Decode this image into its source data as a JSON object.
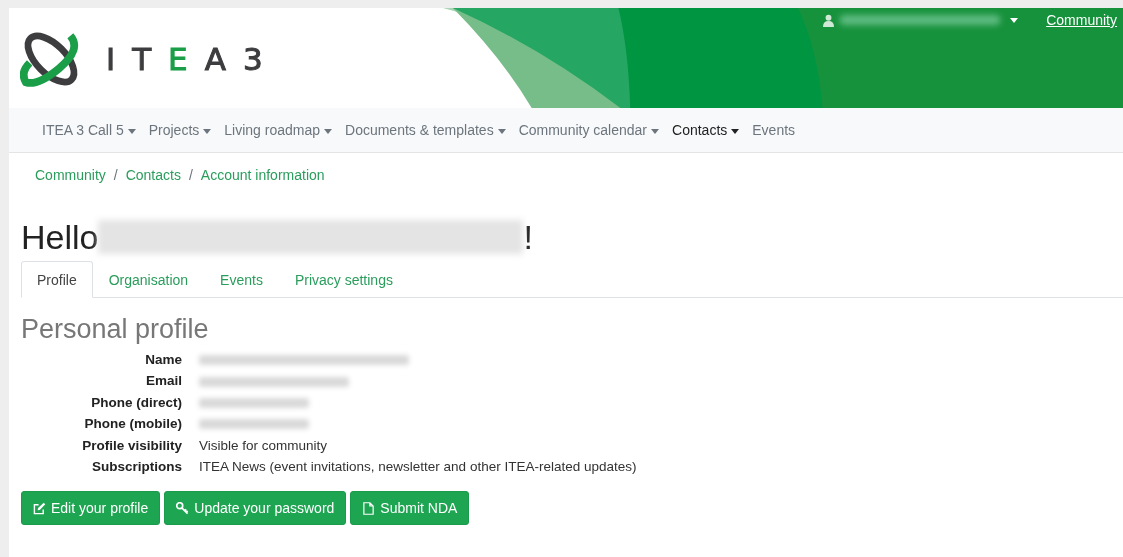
{
  "logo": {
    "letters": [
      {
        "char": "I",
        "color": "#3d3d3f"
      },
      {
        "char": "T",
        "color": "#3d3d3f"
      },
      {
        "char": "E",
        "color": "#1a9e48"
      },
      {
        "char": "A",
        "color": "#3d3d3f"
      },
      {
        "char": "3",
        "color": "#3d3d3f"
      }
    ]
  },
  "user_menu": {
    "name_blurred": true
  },
  "top_link": "Community",
  "nav": [
    {
      "label": "ITEA 3 Call 5",
      "dropdown": true,
      "selected": false
    },
    {
      "label": "Projects",
      "dropdown": true,
      "selected": false
    },
    {
      "label": "Living roadmap",
      "dropdown": true,
      "selected": false
    },
    {
      "label": "Documents & templates",
      "dropdown": true,
      "selected": false
    },
    {
      "label": "Community calendar",
      "dropdown": true,
      "selected": false
    },
    {
      "label": "Contacts",
      "dropdown": true,
      "selected": true
    },
    {
      "label": "Events",
      "dropdown": false,
      "selected": false
    }
  ],
  "breadcrumbs": [
    "Community",
    "Contacts",
    "Account information"
  ],
  "breadcrumb_separator": "/",
  "greeting": {
    "text": "Hello",
    "name_blurred": true,
    "end": "!"
  },
  "tabs": [
    {
      "label": "Profile",
      "selected": true
    },
    {
      "label": "Organisation",
      "selected": false
    },
    {
      "label": "Events",
      "selected": false
    },
    {
      "label": "Privacy settings",
      "selected": false
    }
  ],
  "section_title": "Personal profile",
  "fields": [
    {
      "label": "Name",
      "kind": "blurred"
    },
    {
      "label": "Email",
      "kind": "blurred"
    },
    {
      "label": "Phone (direct)",
      "kind": "blurred"
    },
    {
      "label": "Phone (mobile)",
      "kind": "blurred"
    },
    {
      "label": "Profile visibility",
      "kind": "text",
      "value": "Visible for community"
    },
    {
      "label": "Subscriptions",
      "kind": "text",
      "value": "ITEA News (event invitations, newsletter and other ITEA-related updates)"
    }
  ],
  "buttons": [
    {
      "label": "Edit your profile",
      "kind": "edit"
    },
    {
      "label": "Update your password",
      "kind": "password"
    },
    {
      "label": "Submit NDA",
      "kind": "document"
    }
  ]
}
